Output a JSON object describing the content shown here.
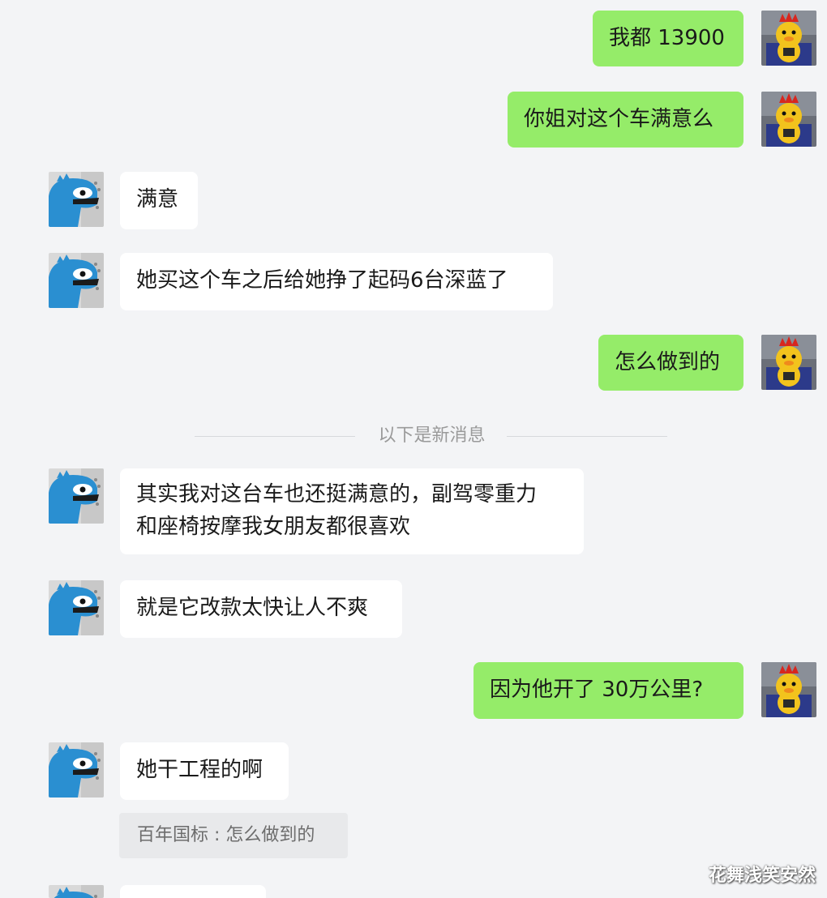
{
  "chat": {
    "messages": [
      {
        "sender": "me",
        "text": "我都 13900"
      },
      {
        "sender": "me",
        "text": "你姐对这个车满意么"
      },
      {
        "sender": "other",
        "text": "满意"
      },
      {
        "sender": "other",
        "text": "她买这个车之后给她挣了起码6台深蓝了"
      },
      {
        "sender": "me",
        "text": "怎么做到的"
      },
      {
        "sender": "other",
        "lines": [
          "其实我对这台车也还挺满意的，副驾零重力",
          "和座椅按摩我女朋友都很喜欢"
        ]
      },
      {
        "sender": "other",
        "text": "就是它改款太快让人不爽"
      },
      {
        "sender": "me",
        "text": "因为他开了 30万公里?"
      },
      {
        "sender": "other",
        "text": "她干工程的啊"
      }
    ],
    "divider_text": "以下是新消息",
    "quote_text": "百年国标 : 怎么做到的"
  },
  "watermark": "花舞浅笑安然",
  "colors": {
    "background": "#f3f4f6",
    "my_bubble": "#95ec69",
    "other_bubble": "#ffffff"
  },
  "icons": {
    "my_avatar": "duck-avatar-icon",
    "other_avatar": "blue-dinosaur-avatar-icon"
  }
}
